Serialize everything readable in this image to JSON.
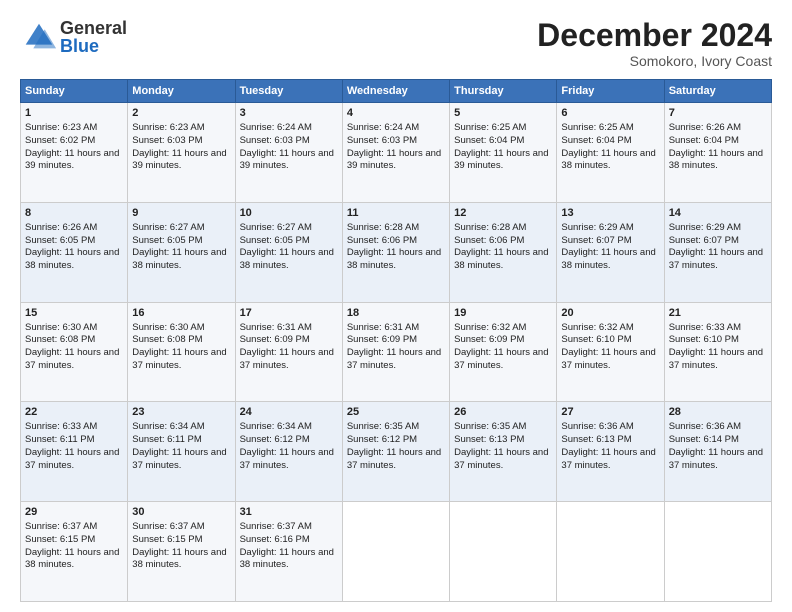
{
  "header": {
    "logo_general": "General",
    "logo_blue": "Blue",
    "month_title": "December 2024",
    "location": "Somokoro, Ivory Coast"
  },
  "calendar": {
    "days_of_week": [
      "Sunday",
      "Monday",
      "Tuesday",
      "Wednesday",
      "Thursday",
      "Friday",
      "Saturday"
    ],
    "weeks": [
      [
        {
          "day": "1",
          "sunrise": "6:23 AM",
          "sunset": "6:02 PM",
          "daylight": "11 hours and 39 minutes."
        },
        {
          "day": "2",
          "sunrise": "6:23 AM",
          "sunset": "6:03 PM",
          "daylight": "11 hours and 39 minutes."
        },
        {
          "day": "3",
          "sunrise": "6:24 AM",
          "sunset": "6:03 PM",
          "daylight": "11 hours and 39 minutes."
        },
        {
          "day": "4",
          "sunrise": "6:24 AM",
          "sunset": "6:03 PM",
          "daylight": "11 hours and 39 minutes."
        },
        {
          "day": "5",
          "sunrise": "6:25 AM",
          "sunset": "6:04 PM",
          "daylight": "11 hours and 39 minutes."
        },
        {
          "day": "6",
          "sunrise": "6:25 AM",
          "sunset": "6:04 PM",
          "daylight": "11 hours and 38 minutes."
        },
        {
          "day": "7",
          "sunrise": "6:26 AM",
          "sunset": "6:04 PM",
          "daylight": "11 hours and 38 minutes."
        }
      ],
      [
        {
          "day": "8",
          "sunrise": "6:26 AM",
          "sunset": "6:05 PM",
          "daylight": "11 hours and 38 minutes."
        },
        {
          "day": "9",
          "sunrise": "6:27 AM",
          "sunset": "6:05 PM",
          "daylight": "11 hours and 38 minutes."
        },
        {
          "day": "10",
          "sunrise": "6:27 AM",
          "sunset": "6:05 PM",
          "daylight": "11 hours and 38 minutes."
        },
        {
          "day": "11",
          "sunrise": "6:28 AM",
          "sunset": "6:06 PM",
          "daylight": "11 hours and 38 minutes."
        },
        {
          "day": "12",
          "sunrise": "6:28 AM",
          "sunset": "6:06 PM",
          "daylight": "11 hours and 38 minutes."
        },
        {
          "day": "13",
          "sunrise": "6:29 AM",
          "sunset": "6:07 PM",
          "daylight": "11 hours and 38 minutes."
        },
        {
          "day": "14",
          "sunrise": "6:29 AM",
          "sunset": "6:07 PM",
          "daylight": "11 hours and 37 minutes."
        }
      ],
      [
        {
          "day": "15",
          "sunrise": "6:30 AM",
          "sunset": "6:08 PM",
          "daylight": "11 hours and 37 minutes."
        },
        {
          "day": "16",
          "sunrise": "6:30 AM",
          "sunset": "6:08 PM",
          "daylight": "11 hours and 37 minutes."
        },
        {
          "day": "17",
          "sunrise": "6:31 AM",
          "sunset": "6:09 PM",
          "daylight": "11 hours and 37 minutes."
        },
        {
          "day": "18",
          "sunrise": "6:31 AM",
          "sunset": "6:09 PM",
          "daylight": "11 hours and 37 minutes."
        },
        {
          "day": "19",
          "sunrise": "6:32 AM",
          "sunset": "6:09 PM",
          "daylight": "11 hours and 37 minutes."
        },
        {
          "day": "20",
          "sunrise": "6:32 AM",
          "sunset": "6:10 PM",
          "daylight": "11 hours and 37 minutes."
        },
        {
          "day": "21",
          "sunrise": "6:33 AM",
          "sunset": "6:10 PM",
          "daylight": "11 hours and 37 minutes."
        }
      ],
      [
        {
          "day": "22",
          "sunrise": "6:33 AM",
          "sunset": "6:11 PM",
          "daylight": "11 hours and 37 minutes."
        },
        {
          "day": "23",
          "sunrise": "6:34 AM",
          "sunset": "6:11 PM",
          "daylight": "11 hours and 37 minutes."
        },
        {
          "day": "24",
          "sunrise": "6:34 AM",
          "sunset": "6:12 PM",
          "daylight": "11 hours and 37 minutes."
        },
        {
          "day": "25",
          "sunrise": "6:35 AM",
          "sunset": "6:12 PM",
          "daylight": "11 hours and 37 minutes."
        },
        {
          "day": "26",
          "sunrise": "6:35 AM",
          "sunset": "6:13 PM",
          "daylight": "11 hours and 37 minutes."
        },
        {
          "day": "27",
          "sunrise": "6:36 AM",
          "sunset": "6:13 PM",
          "daylight": "11 hours and 37 minutes."
        },
        {
          "day": "28",
          "sunrise": "6:36 AM",
          "sunset": "6:14 PM",
          "daylight": "11 hours and 37 minutes."
        }
      ],
      [
        {
          "day": "29",
          "sunrise": "6:37 AM",
          "sunset": "6:15 PM",
          "daylight": "11 hours and 38 minutes."
        },
        {
          "day": "30",
          "sunrise": "6:37 AM",
          "sunset": "6:15 PM",
          "daylight": "11 hours and 38 minutes."
        },
        {
          "day": "31",
          "sunrise": "6:37 AM",
          "sunset": "6:16 PM",
          "daylight": "11 hours and 38 minutes."
        },
        null,
        null,
        null,
        null
      ]
    ]
  }
}
